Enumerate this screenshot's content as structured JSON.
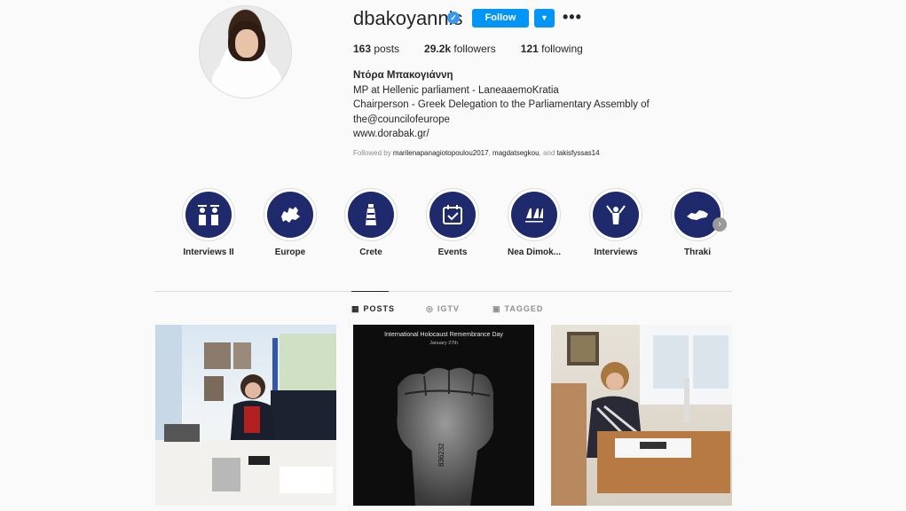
{
  "profile": {
    "username": "dbakoyannis",
    "verified_icon": "✓",
    "follow_label": "Follow",
    "dropdown_icon": "▼",
    "more_icon": "•••",
    "stats": {
      "posts_count": "163",
      "posts_label": " posts",
      "followers_count": "29.2k",
      "followers_label": " followers",
      "following_count": "121",
      "following_label": " following"
    },
    "bio": {
      "full_name": "Ντόρα Μπακογιάννη",
      "line1": "MP at Hellenic parliament - LaneaaemoKratia",
      "line2": "Chairperson - Greek Delegation to the Parliamentary Assembly of",
      "line3": "the@councilofeurope",
      "website": "www.dorabak.gr/"
    },
    "followed_by": {
      "prefix": "Followed by ",
      "user1": "marilenapanagiotopoulou2017",
      "sep1": ", ",
      "user2": "magdatsegkou",
      "sep2": ", and ",
      "user3": "takisfyssas14"
    }
  },
  "highlights": [
    {
      "label": "Interviews II",
      "icon": "podium-icon"
    },
    {
      "label": "Europe",
      "icon": "europe-map-icon"
    },
    {
      "label": "Crete",
      "icon": "lighthouse-icon"
    },
    {
      "label": "Events",
      "icon": "calendar-check-icon"
    },
    {
      "label": "Nea Dimok...",
      "icon": "nd-logo-icon"
    },
    {
      "label": "Interviews",
      "icon": "person-mics-icon"
    },
    {
      "label": "Thraki",
      "icon": "map-region-icon"
    }
  ],
  "highlights_next_icon": "›",
  "tabs": {
    "posts": "POSTS",
    "igtv": "IGTV",
    "tagged": "TAGGED"
  },
  "posts": [
    {
      "kind": "photo-office"
    },
    {
      "kind": "poster",
      "caption": "International Holocaust Remembrance Day",
      "subcaption": "January 27th",
      "wrist_number": "836232"
    },
    {
      "kind": "photo-desk"
    }
  ],
  "colors": {
    "accent": "#0095f6",
    "highlight_bg": "#1e2a6b",
    "muted_text": "#8e8e8e"
  }
}
